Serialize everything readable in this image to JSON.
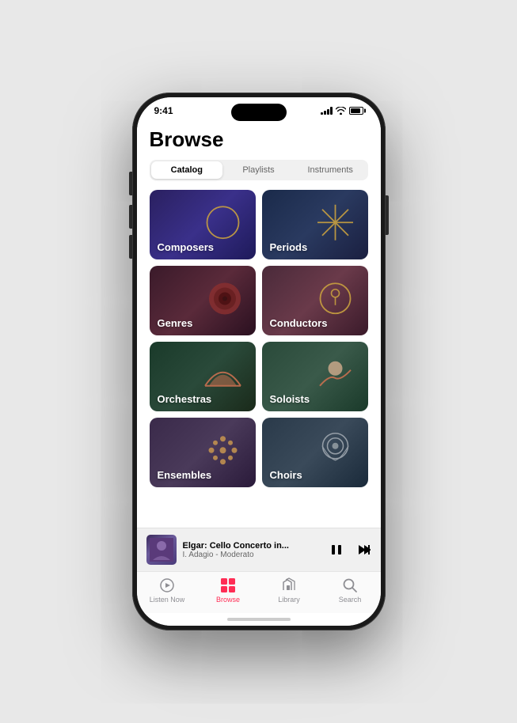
{
  "statusBar": {
    "time": "9:41"
  },
  "page": {
    "title": "Browse"
  },
  "tabs": [
    {
      "label": "Catalog",
      "active": true
    },
    {
      "label": "Playlists",
      "active": false
    },
    {
      "label": "Instruments",
      "active": false
    }
  ],
  "gridItems": [
    {
      "id": "composers",
      "label": "Composers",
      "bgClass": "composers-bg"
    },
    {
      "id": "periods",
      "label": "Periods",
      "bgClass": "periods-bg"
    },
    {
      "id": "genres",
      "label": "Genres",
      "bgClass": "genres-bg"
    },
    {
      "id": "conductors",
      "label": "Conductors",
      "bgClass": "conductors-bg"
    },
    {
      "id": "orchestras",
      "label": "Orchestras",
      "bgClass": "orchestras-bg"
    },
    {
      "id": "soloists",
      "label": "Soloists",
      "bgClass": "soloists-bg"
    },
    {
      "id": "ensembles",
      "label": "Ensembles",
      "bgClass": "ensembles-bg"
    },
    {
      "id": "choirs",
      "label": "Choirs",
      "bgClass": "choirs-bg"
    }
  ],
  "miniPlayer": {
    "title": "Elgar: Cello Concerto in...",
    "subtitle": "I. Adagio - Moderato"
  },
  "bottomNav": [
    {
      "id": "listen-now",
      "label": "Listen Now",
      "active": false
    },
    {
      "id": "browse",
      "label": "Browse",
      "active": true
    },
    {
      "id": "library",
      "label": "Library",
      "active": false
    },
    {
      "id": "search",
      "label": "Search",
      "active": false
    }
  ]
}
